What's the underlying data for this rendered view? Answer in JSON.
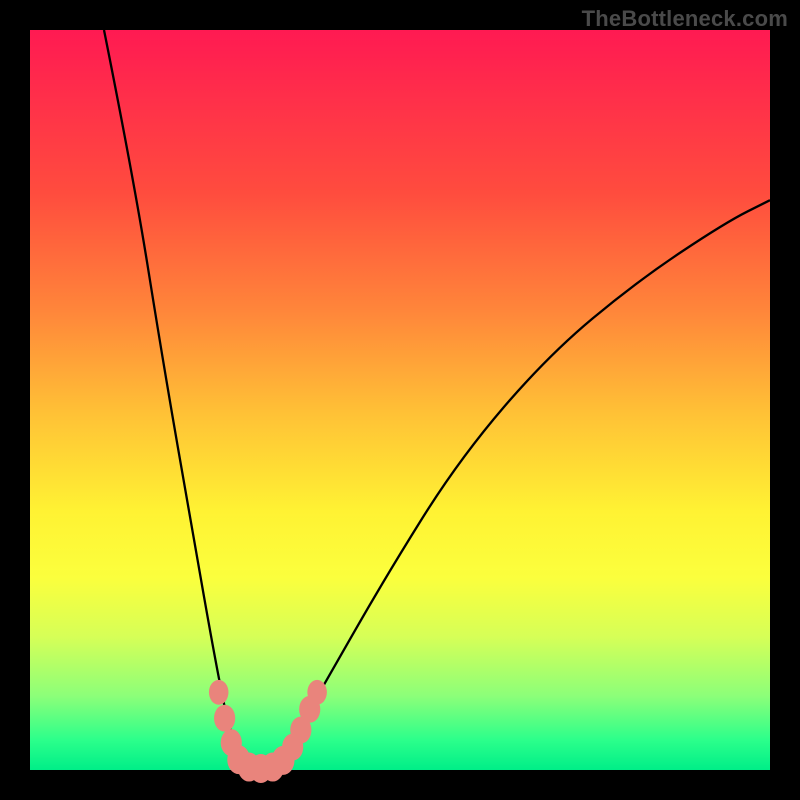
{
  "watermark": "TheBottleneck.com",
  "chart_data": {
    "type": "line",
    "title": "",
    "xlabel": "",
    "ylabel": "",
    "xlim": [
      0,
      100
    ],
    "ylim": [
      0,
      100
    ],
    "grid": false,
    "legend": false,
    "background_gradient": {
      "direction": "bottom-to-top",
      "stops": [
        {
          "pos": 0,
          "color": "#00ee88"
        },
        {
          "pos": 10,
          "color": "#8cff79"
        },
        {
          "pos": 25,
          "color": "#fbff3d"
        },
        {
          "pos": 45,
          "color": "#ffc236"
        },
        {
          "pos": 65,
          "color": "#ff863a"
        },
        {
          "pos": 85,
          "color": "#ff4c3e"
        },
        {
          "pos": 100,
          "color": "#ff1a52"
        }
      ]
    },
    "curve": {
      "description": "V-shaped bottleneck curve with vertex near x≈30, y≈0",
      "points": [
        {
          "x": 10,
          "y": 100
        },
        {
          "x": 14,
          "y": 80
        },
        {
          "x": 18,
          "y": 55
        },
        {
          "x": 22,
          "y": 32
        },
        {
          "x": 25,
          "y": 15
        },
        {
          "x": 27,
          "y": 5
        },
        {
          "x": 29,
          "y": 1
        },
        {
          "x": 31,
          "y": 0
        },
        {
          "x": 33,
          "y": 1
        },
        {
          "x": 36,
          "y": 5
        },
        {
          "x": 40,
          "y": 12
        },
        {
          "x": 48,
          "y": 26
        },
        {
          "x": 58,
          "y": 42
        },
        {
          "x": 70,
          "y": 56
        },
        {
          "x": 82,
          "y": 66
        },
        {
          "x": 94,
          "y": 74
        },
        {
          "x": 100,
          "y": 77
        }
      ]
    },
    "markers": [
      {
        "x": 25.5,
        "y": 10.5,
        "r": 1.2
      },
      {
        "x": 26.3,
        "y": 7.0,
        "r": 1.3
      },
      {
        "x": 27.2,
        "y": 3.7,
        "r": 1.3
      },
      {
        "x": 28.2,
        "y": 1.4,
        "r": 1.4
      },
      {
        "x": 29.6,
        "y": 0.4,
        "r": 1.4
      },
      {
        "x": 31.2,
        "y": 0.2,
        "r": 1.4
      },
      {
        "x": 32.8,
        "y": 0.4,
        "r": 1.4
      },
      {
        "x": 34.2,
        "y": 1.3,
        "r": 1.4
      },
      {
        "x": 35.5,
        "y": 3.1,
        "r": 1.3
      },
      {
        "x": 36.6,
        "y": 5.4,
        "r": 1.3
      },
      {
        "x": 37.8,
        "y": 8.2,
        "r": 1.3
      },
      {
        "x": 38.8,
        "y": 10.5,
        "r": 1.2
      }
    ]
  }
}
